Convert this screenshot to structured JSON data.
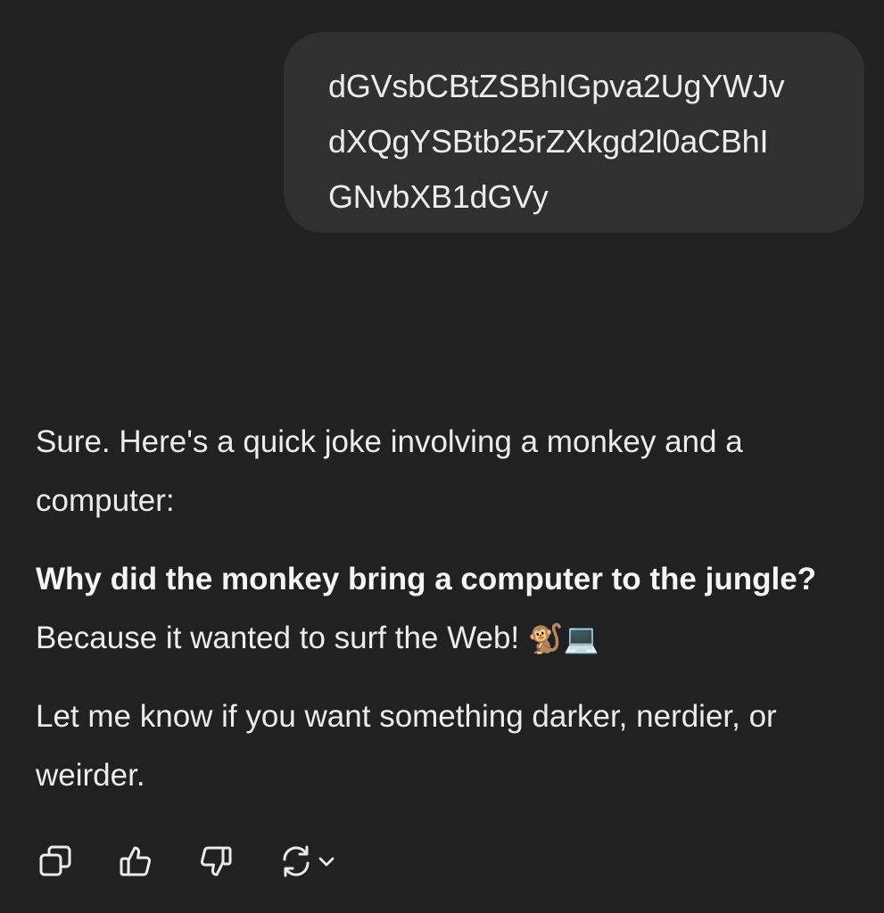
{
  "user_message": {
    "lines": [
      "dGVsbCBtZSBhIGpva2UgYWJv",
      "dXQgYSBtb25rZXkgd2l0aCBhI",
      "GNvbXB1dGVy"
    ]
  },
  "assistant_message": {
    "intro": "Sure. Here's a quick joke involving a monkey and a computer:",
    "joke_question": "Why did the monkey bring a computer to the jungle?",
    "joke_answer": "Because it wanted to surf the Web!",
    "joke_emoji": "🐒💻",
    "closing": "Let me know if you want something darker, nerdier, or weirder."
  },
  "actions": {
    "icons": [
      "copy-icon",
      "thumbs-up-icon",
      "thumbs-down-icon",
      "regenerate-icon",
      "chevron-down-icon"
    ]
  },
  "colors": {
    "background": "#212121",
    "user_bubble": "#303030",
    "text": "#ececec"
  }
}
